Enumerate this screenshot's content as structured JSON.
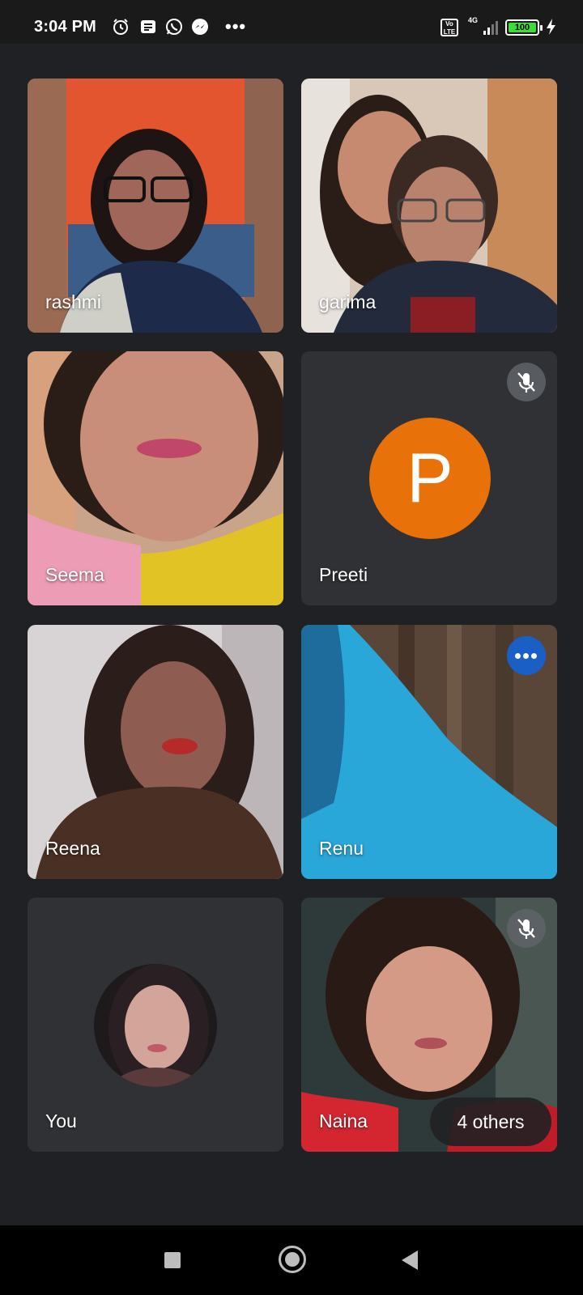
{
  "status_bar": {
    "time": "3:04 PM",
    "icons": [
      "alarm-icon",
      "notification-icon",
      "whatsapp-icon",
      "messenger-icon"
    ],
    "more": "•••",
    "volte": "Vo LTE",
    "network": "4G",
    "battery": "100"
  },
  "tiles": [
    {
      "name": "rashmi",
      "type": "video",
      "muted": false
    },
    {
      "name": "garima",
      "type": "video",
      "muted": false
    },
    {
      "name": "Seema",
      "type": "video",
      "muted": false
    },
    {
      "name": "Preeti",
      "type": "avatar",
      "initial": "P",
      "avatar_color": "#e8710a",
      "muted": true
    },
    {
      "name": "Reena",
      "type": "video",
      "muted": false
    },
    {
      "name": "Renu",
      "type": "video",
      "speaking": true
    },
    {
      "name": "You",
      "type": "self-avatar",
      "muted": false
    },
    {
      "name": "Naina",
      "type": "video",
      "muted": true
    }
  ],
  "others_chip": "4 others",
  "colors": {
    "background": "#202124",
    "accent_orange": "#e8710a",
    "speaking_blue": "#1a5fc6"
  }
}
